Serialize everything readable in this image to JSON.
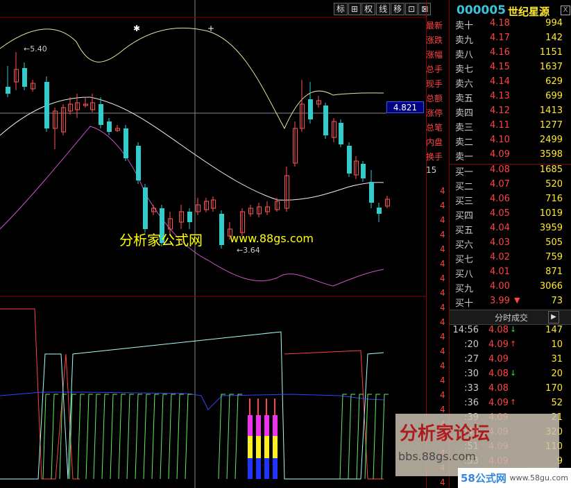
{
  "toolbar": {
    "buttons": [
      "标",
      "⊞",
      "权",
      "线",
      "移",
      "⊡",
      "⊠"
    ]
  },
  "chart_data": {
    "type": "candlestick",
    "annotations": {
      "high": "5.40",
      "low": "3.64"
    },
    "current_price_tag": "4.821"
  },
  "watermarks": {
    "cn": "分析家公式网",
    "url": "www.88gs.com",
    "box_title": "分析家论坛",
    "box_url": "bbs.88gs.com",
    "logo": "58公式网",
    "logo_url": "www.58gu.com"
  },
  "stock": {
    "code": "000005",
    "name": "世纪星源",
    "close": "X"
  },
  "side_labels": [
    "最新",
    "涨跌",
    "涨幅",
    "总手",
    "现手",
    "总额",
    "涨停",
    "总笔",
    "内盘",
    "换手",
    "15"
  ],
  "order_book": {
    "sell": [
      {
        "label": "卖十",
        "price": "4.18",
        "vol": "994"
      },
      {
        "label": "卖九",
        "price": "4.17",
        "vol": "142"
      },
      {
        "label": "卖八",
        "price": "4.16",
        "vol": "1151"
      },
      {
        "label": "卖七",
        "price": "4.15",
        "vol": "1637"
      },
      {
        "label": "卖六",
        "price": "4.14",
        "vol": "629"
      },
      {
        "label": "卖五",
        "price": "4.13",
        "vol": "699"
      },
      {
        "label": "卖四",
        "price": "4.12",
        "vol": "1413"
      },
      {
        "label": "卖三",
        "price": "4.11",
        "vol": "1277"
      },
      {
        "label": "卖二",
        "price": "4.10",
        "vol": "2499"
      },
      {
        "label": "卖一",
        "price": "4.09",
        "vol": "3598"
      }
    ],
    "buy": [
      {
        "label": "买一",
        "price": "4.08",
        "vol": "1685",
        "arrow": ""
      },
      {
        "label": "买二",
        "price": "4.07",
        "vol": "520",
        "arrow": ""
      },
      {
        "label": "买三",
        "price": "4.06",
        "vol": "716",
        "arrow": ""
      },
      {
        "label": "买四",
        "price": "4.05",
        "vol": "1019",
        "arrow": ""
      },
      {
        "label": "买五",
        "price": "4.04",
        "vol": "3959",
        "arrow": ""
      },
      {
        "label": "买六",
        "price": "4.03",
        "vol": "505",
        "arrow": ""
      },
      {
        "label": "买七",
        "price": "4.02",
        "vol": "759",
        "arrow": ""
      },
      {
        "label": "买八",
        "price": "4.01",
        "vol": "871",
        "arrow": ""
      },
      {
        "label": "买九",
        "price": "4.00",
        "vol": "3066",
        "arrow": ""
      },
      {
        "label": "买十",
        "price": "3.99",
        "vol": "73",
        "arrow": "▼"
      }
    ]
  },
  "ticks": {
    "header": "分时成交",
    "header_btn": "▶",
    "rows": [
      {
        "time": "14:56",
        "price": "4.08",
        "arrow": "↓",
        "arrow_color": "#33dd33",
        "vol": "147"
      },
      {
        "time": ":20",
        "price": "4.09",
        "arrow": "↑",
        "arrow_color": "#ff4444",
        "vol": "10"
      },
      {
        "time": ":27",
        "price": "4.09",
        "arrow": "",
        "arrow_color": "#ff4444",
        "vol": "31"
      },
      {
        "time": ":30",
        "price": "4.08",
        "arrow": "↓",
        "arrow_color": "#33dd33",
        "vol": "20"
      },
      {
        "time": ":33",
        "price": "4.08",
        "arrow": "",
        "arrow_color": "#ff4444",
        "vol": "170"
      },
      {
        "time": ":36",
        "price": "4.09",
        "arrow": "↑",
        "arrow_color": "#ff4444",
        "vol": "52"
      },
      {
        "time": ":39",
        "price": "4.09",
        "arrow": "",
        "arrow_color": "#ff4444",
        "vol": "21"
      },
      {
        "time": ":41",
        "price": "4.09",
        "arrow": "",
        "arrow_color": "#ff4444",
        "vol": "320"
      },
      {
        "time": ":51",
        "price": "4.09",
        "arrow": "",
        "arrow_color": "#ff4444",
        "vol": "110"
      },
      {
        "time": ":53",
        "price": "4.09",
        "arrow": "",
        "arrow_color": "#ff4444",
        "vol": "9"
      }
    ]
  }
}
